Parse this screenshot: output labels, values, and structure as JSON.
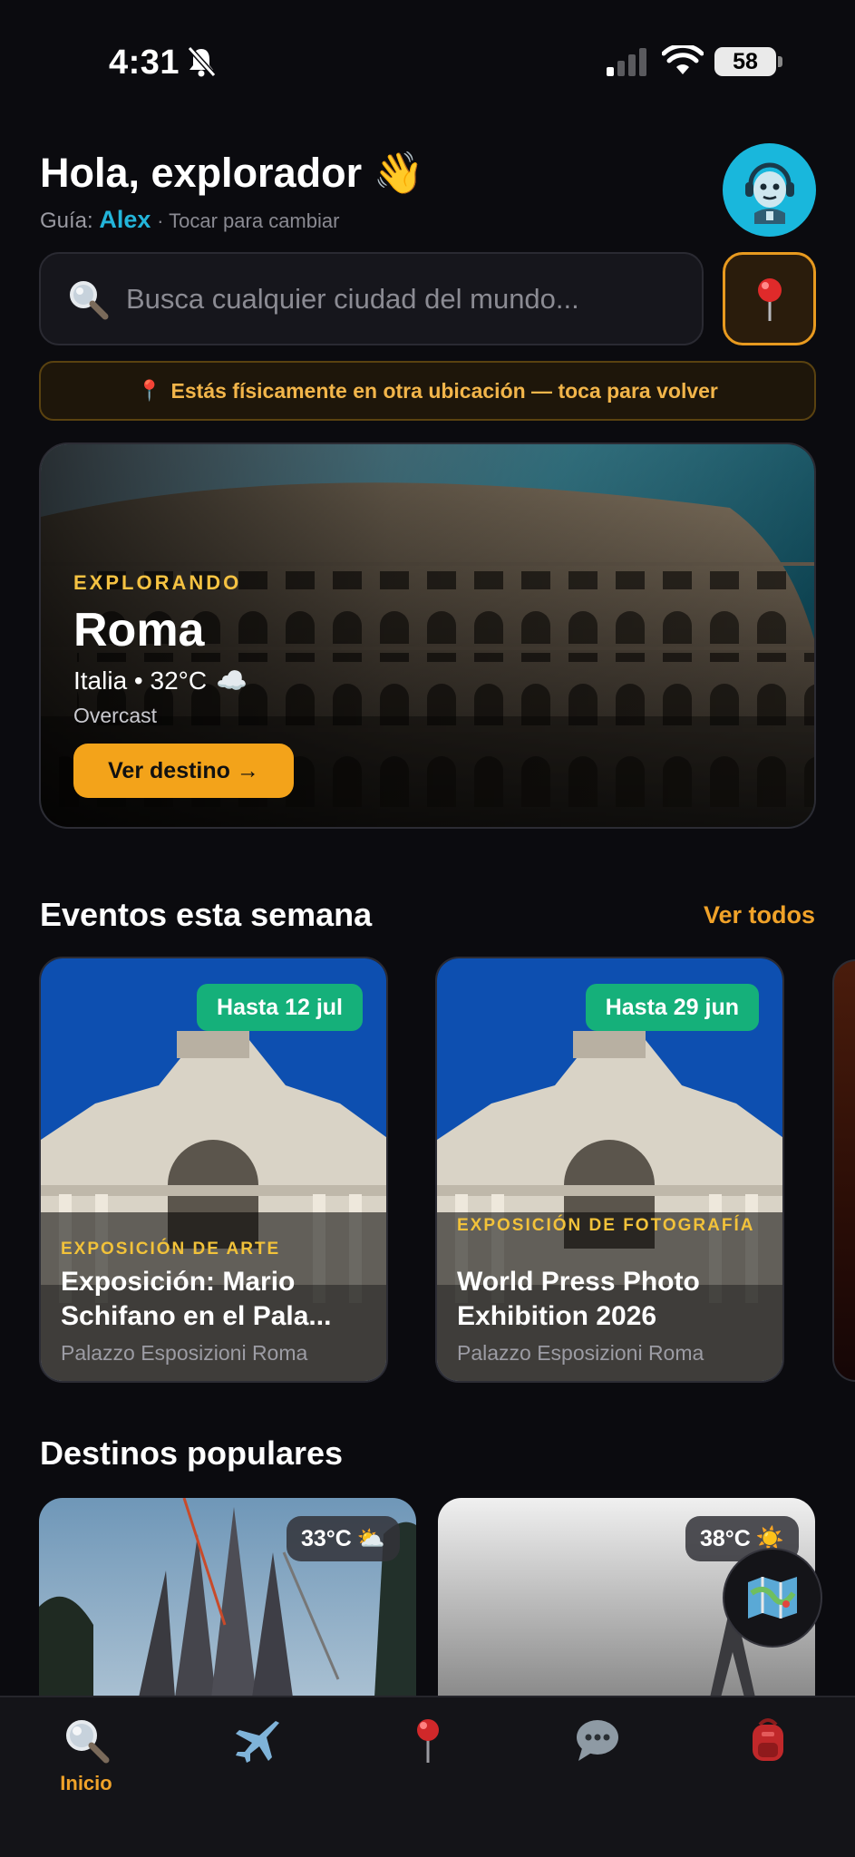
{
  "status_bar": {
    "time": "4:31",
    "battery": "58"
  },
  "header": {
    "greeting": "Hola, explorador 👋",
    "guide_label": "Guía:",
    "guide_name": "Alex",
    "guide_hint": "· Tocar para cambiar"
  },
  "search": {
    "placeholder": "Busca cualquier ciudad del mundo..."
  },
  "location_banner": {
    "icon": "📍",
    "text": "Estás físicamente en otra ubicación — toca para volver"
  },
  "hero": {
    "kicker": "EXPLORANDO",
    "city": "Roma",
    "country_temp": "Italia • 32°C",
    "weather_icon": "☁️",
    "condition": "Overcast",
    "button": "Ver destino →"
  },
  "events": {
    "title": "Eventos esta semana",
    "see_all": "Ver todos",
    "items": [
      {
        "badge": "Hasta 12 jul",
        "kicker": "EXPOSICIÓN DE ARTE",
        "title": "Exposición: Mario Schifano en el Pala...",
        "venue": "Palazzo Esposizioni Roma"
      },
      {
        "badge": "Hasta 29 jun",
        "kicker": "EXPOSICIÓN DE FOTOGRAFÍA",
        "title": "World Press Photo Exhibition 2026",
        "venue": "Palazzo Esposizioni Roma"
      }
    ]
  },
  "destinations": {
    "title": "Destinos populares",
    "items": [
      {
        "temp": "33°C",
        "weather_icon": "⛅"
      },
      {
        "temp": "38°C",
        "weather_icon": "☀️"
      }
    ]
  },
  "tabs": {
    "items": [
      {
        "icon": "search-icon",
        "label": "Inicio",
        "active": true
      },
      {
        "icon": "airplane-icon",
        "label": ""
      },
      {
        "icon": "map-pin-icon",
        "label": ""
      },
      {
        "icon": "chat-icon",
        "label": ""
      },
      {
        "icon": "backpack-icon",
        "label": ""
      }
    ]
  },
  "colors": {
    "accent": "#f0a229",
    "guide": "#23b5da",
    "badge": "#15b07a",
    "background": "#0b0b0f"
  }
}
